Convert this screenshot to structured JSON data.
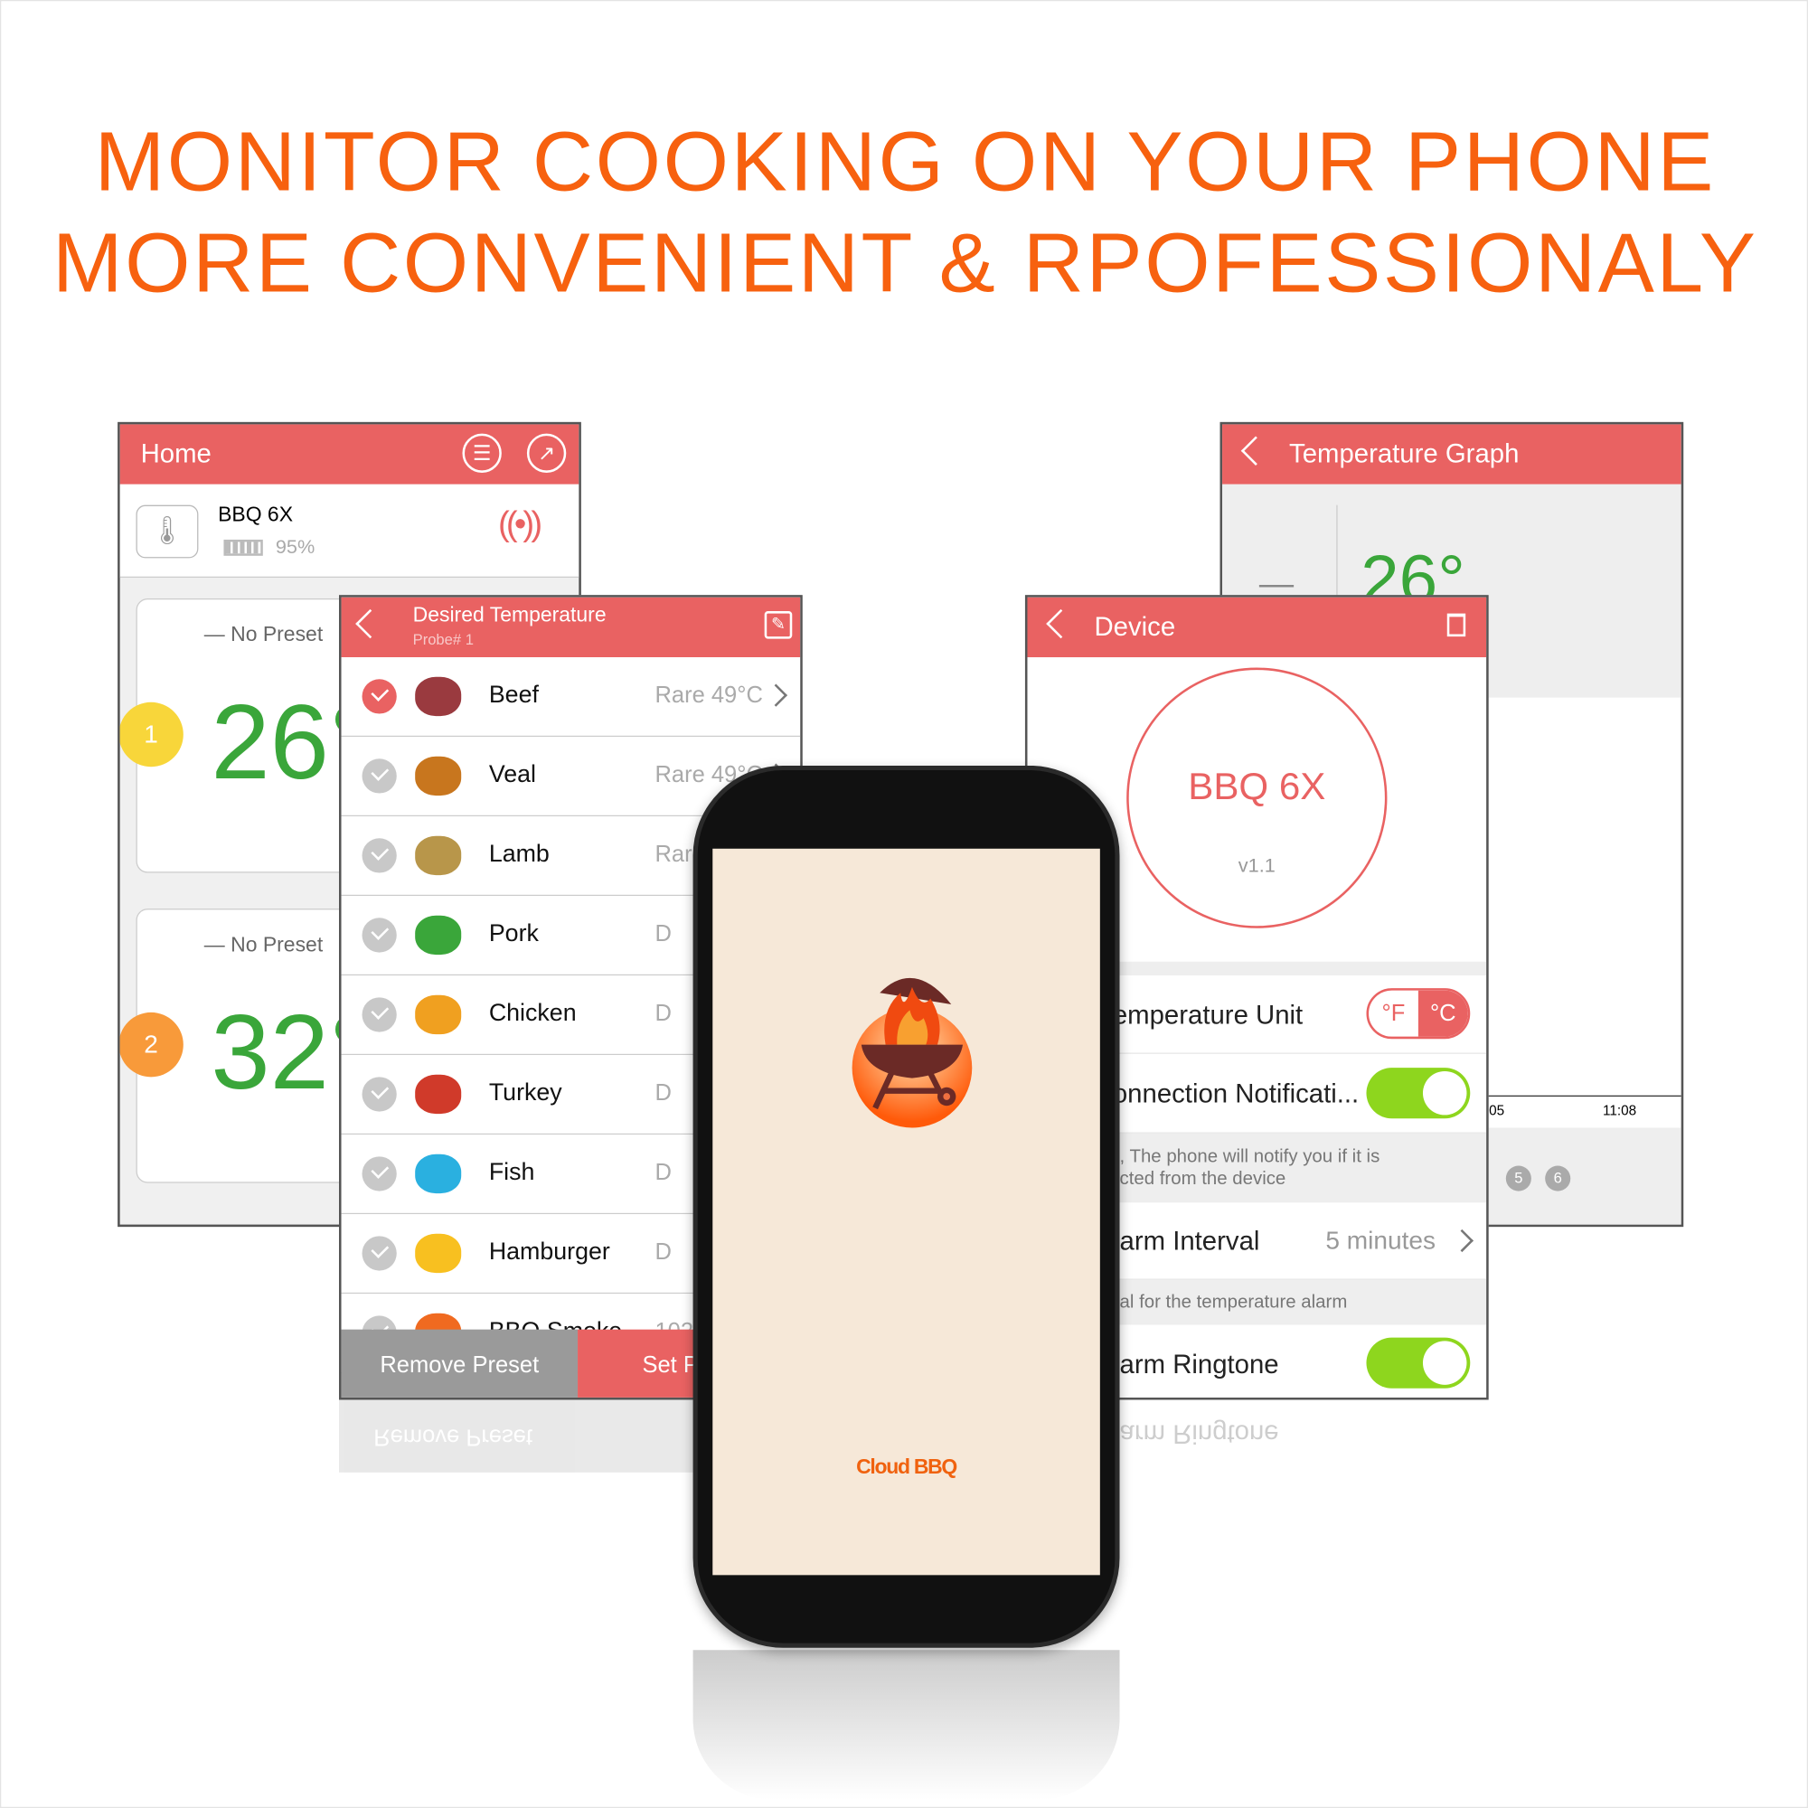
{
  "headline": {
    "line1": "MONITOR COOKING ON YOUR PHONE",
    "line2": "MORE CONVENIENT & RPOFESSIONALY"
  },
  "colors": {
    "accent": "#e96262",
    "headline": "#f7610f",
    "temp_green": "#3aa63a",
    "toggle_on": "#8ed61e",
    "splash_bg": "#f6e8d8"
  },
  "home": {
    "title": "Home",
    "icons": [
      "list-icon",
      "trend-chart-icon"
    ],
    "device_name": "BBQ 6X",
    "battery": "95%",
    "battery_level": 0.95,
    "probes": [
      {
        "number": "1",
        "preset": "No Preset",
        "temp": "26°",
        "badge_color": "#f8d63a"
      },
      {
        "number": "2",
        "preset": "No Preset",
        "temp": "32°",
        "badge_color": "#f89a3a"
      }
    ]
  },
  "desired": {
    "title": "Desired Temperature",
    "subtitle": "Probe# 1",
    "items": [
      {
        "name": "Beef",
        "value": "Rare 49°C",
        "selected": true,
        "color": "#9a3a3f"
      },
      {
        "name": "Veal",
        "value": "Rare 49°C",
        "selected": false,
        "color": "#c8761e"
      },
      {
        "name": "Lamb",
        "value": "Rare",
        "selected": false,
        "color": "#b8964a"
      },
      {
        "name": "Pork",
        "value": "D",
        "selected": false,
        "color": "#3aa63a"
      },
      {
        "name": "Chicken",
        "value": "D",
        "selected": false,
        "color": "#f0a020"
      },
      {
        "name": "Turkey",
        "value": "D",
        "selected": false,
        "color": "#d03a2a"
      },
      {
        "name": "Fish",
        "value": "D",
        "selected": false,
        "color": "#2ab0e0"
      },
      {
        "name": "Hamburger",
        "value": "D",
        "selected": false,
        "color": "#f8c020"
      },
      {
        "name": "BBQ Smoke",
        "value": "102",
        "selected": false,
        "color": "#f06a20"
      }
    ],
    "remove_label": "Remove Preset",
    "set_label": "Set P"
  },
  "graph": {
    "title": "Temperature Graph",
    "dash": "—",
    "temp": "26°",
    "x_ticks": [
      ":05",
      "11:08"
    ],
    "probe_circles": [
      "5",
      "6"
    ]
  },
  "device": {
    "title": "Device",
    "name": "BBQ 6X",
    "version": "v1.1",
    "unit_label": "emperature Unit",
    "unit_f": "°F",
    "unit_c": "°C",
    "unit_selected": "°C",
    "conn_label": "onnection Notificati...",
    "conn_on": true,
    "conn_desc1": ", The phone will notify you if it is",
    "conn_desc2": "cted from the device",
    "interval_label": "arm Interval",
    "interval_value": "5 minutes",
    "interval_desc": "al for the temperature alarm",
    "ringtone_label": "arm Ringtone",
    "ringtone_on": true
  },
  "splash": {
    "brand": "Cloud BBQ"
  }
}
